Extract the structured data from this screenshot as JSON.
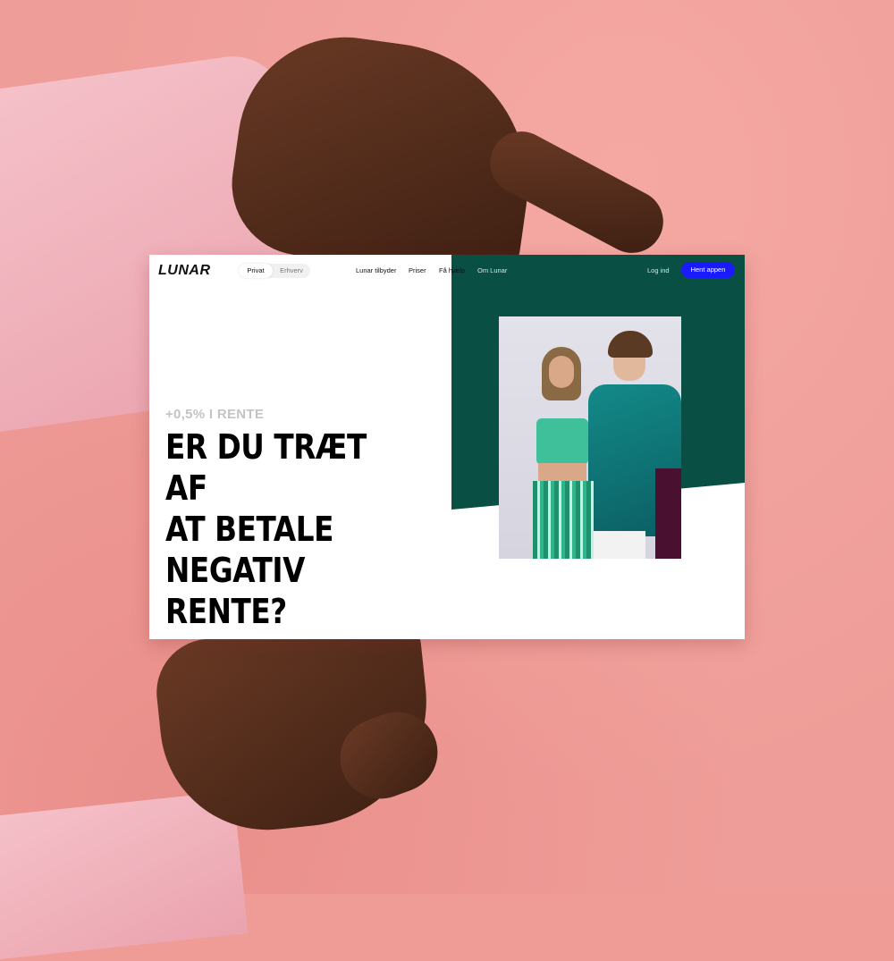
{
  "nav": {
    "logo": "LUNAR",
    "segments": [
      "Privat",
      "Erhverv"
    ],
    "links": [
      "Lunar tilbyder",
      "Priser",
      "Få hjælp",
      "Om Lunar"
    ],
    "login": "Log ind",
    "cta": "Hent appen"
  },
  "hero": {
    "kicker": "+0,5% I RENTE",
    "headline": [
      "ER DU TRÆT AF",
      "AT BETALE",
      "NEGATIV",
      "RENTE?"
    ]
  },
  "colors": {
    "background": "#ef9c97",
    "green_panel": "#0a4f44",
    "cta": "#1a1aff"
  }
}
